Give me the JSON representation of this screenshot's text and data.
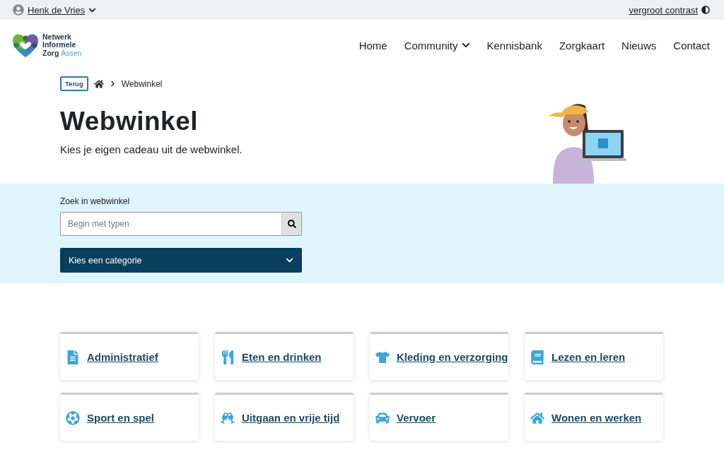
{
  "top_bar": {
    "user": "Henk de Vries",
    "contrast_link": "vergroot contrast"
  },
  "logo": {
    "line_1": "Netwerk",
    "line_2": "Informele",
    "line_3": "Zorg",
    "line_3_suffix": "Assen"
  },
  "nav": [
    {
      "label": "Home",
      "has_menu": false
    },
    {
      "label": "Community",
      "has_menu": true
    },
    {
      "label": "Kennisbank",
      "has_menu": false
    },
    {
      "label": "Zorgkaart",
      "has_menu": false
    },
    {
      "label": "Nieuws",
      "has_menu": false
    },
    {
      "label": "Contact",
      "has_menu": false
    }
  ],
  "breadcrumb": {
    "back": "Terug",
    "current": "Webwinkel"
  },
  "hero": {
    "title": "Webwinkel",
    "subtitle": "Kies je eigen cadeau uit de webwinkel."
  },
  "search": {
    "label": "Zoek in webwinkel",
    "placeholder": "Begin met typen",
    "category_select": "Kies een categorie"
  },
  "categories": [
    {
      "label": "Administratief",
      "kind": "document"
    },
    {
      "label": "Eten en drinken",
      "kind": "food"
    },
    {
      "label": "Kleding en verzorging",
      "kind": "clothing"
    },
    {
      "label": "Lezen en leren",
      "kind": "books"
    },
    {
      "label": "Sport en spel",
      "kind": "ball"
    },
    {
      "label": "Uitgaan en vrije tijd",
      "kind": "glasses"
    },
    {
      "label": "Vervoer",
      "kind": "car"
    },
    {
      "label": "Wonen en werken",
      "kind": "house"
    }
  ]
}
